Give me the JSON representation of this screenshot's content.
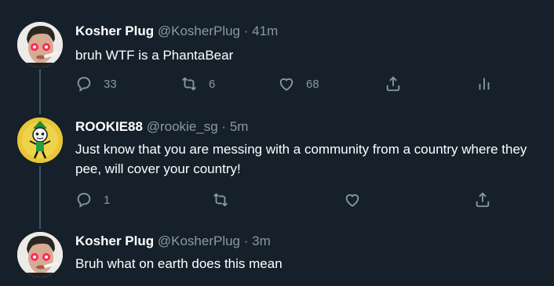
{
  "tweets": [
    {
      "name": "Kosher Plug",
      "handle": "@KosherPlug",
      "dot": "·",
      "time": "41m",
      "text": "bruh WTF is a PhantaBear",
      "actions": {
        "reply": "33",
        "retweet": "6",
        "like": "68"
      }
    },
    {
      "name": "ROOKIE88",
      "handle": "@rookie_sg",
      "dot": "·",
      "time": "5m",
      "text": "Just know that you are messing with a community from a country where they pee, will cover your country!",
      "actions": {
        "reply": "1",
        "retweet": "",
        "like": ""
      }
    },
    {
      "name": "Kosher Plug",
      "handle": "@KosherPlug",
      "dot": "·",
      "time": "3m",
      "text": "Bruh what on earth does this mean"
    }
  ],
  "icons": {
    "reply": "reply-icon",
    "retweet": "retweet-icon",
    "like": "heart-icon",
    "share": "share-icon",
    "analytics": "analytics-icon"
  },
  "colors": {
    "background": "#15202b",
    "primary_text": "#ffffff",
    "secondary_text": "#8b98a5",
    "thread_line": "#3d5466"
  }
}
